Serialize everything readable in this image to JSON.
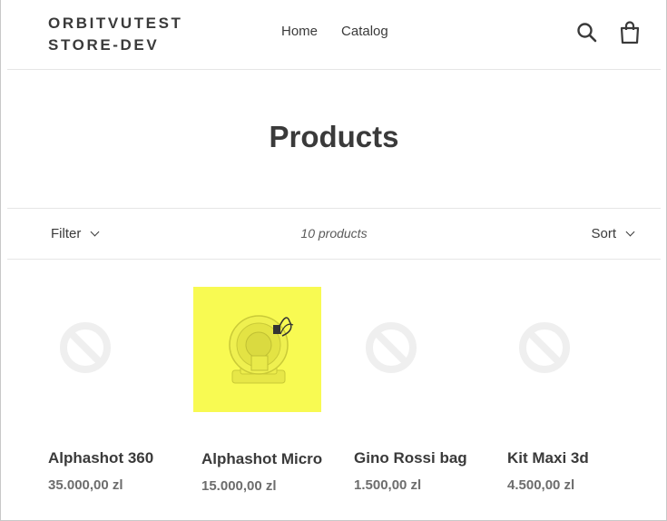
{
  "store": {
    "name_line1": "ORBITVUTEST",
    "name_line2": "STORE-DEV"
  },
  "nav": {
    "home": "Home",
    "catalog": "Catalog"
  },
  "icons": {
    "search": "search-icon",
    "cart": "cart-icon",
    "placeholder": "no-image-placeholder-icon"
  },
  "page": {
    "title": "Products"
  },
  "toolbar": {
    "filter_label": "Filter",
    "count": "10 products",
    "sort_label": "Sort"
  },
  "colors": {
    "text": "#3a3a3a",
    "price": "#6d6d6d",
    "product_bg": "#f8fa52"
  },
  "products": [
    {
      "name": "Alphashot 360",
      "price": "35.000,00 zl",
      "has_image": false
    },
    {
      "name": "Alphashot Micro",
      "price": "15.000,00 zl",
      "has_image": true
    },
    {
      "name": "Gino Rossi bag",
      "price": "1.500,00 zl",
      "has_image": false
    },
    {
      "name": "Kit Maxi 3d",
      "price": "4.500,00 zl",
      "has_image": false
    }
  ]
}
